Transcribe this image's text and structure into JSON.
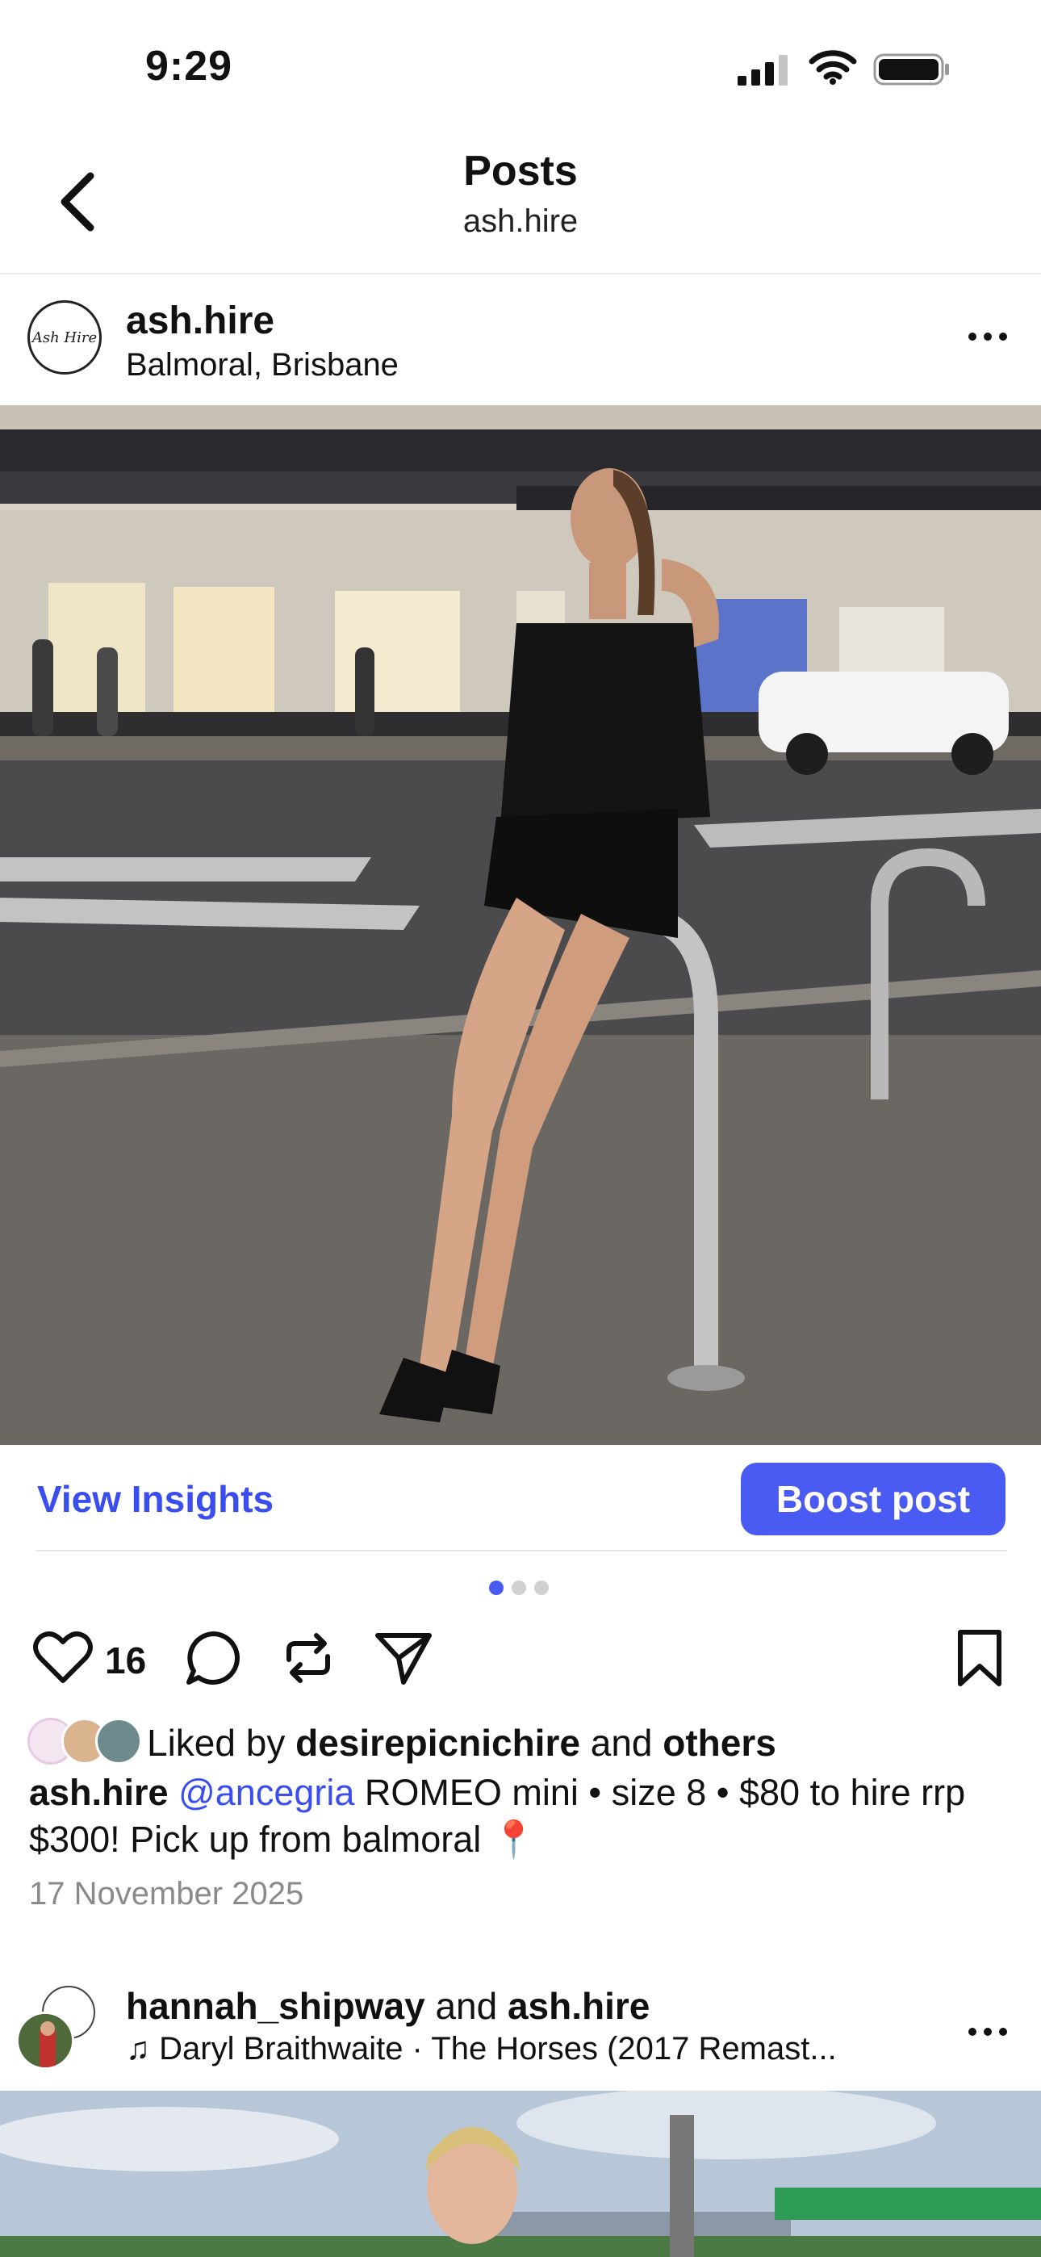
{
  "status_bar": {
    "time": "9:29"
  },
  "nav": {
    "title": "Posts",
    "subtitle": "ash.hire"
  },
  "post": {
    "avatar_text": "Ash Hire",
    "username": "ash.hire",
    "location": "Balmoral, Brisbane",
    "view_insights_label": "View Insights",
    "boost_label": "Boost post",
    "like_count": "16",
    "liked_by_prefix": "Liked by",
    "liked_by_user": "desirepicnichire",
    "liked_by_and": "and",
    "liked_by_others": "others",
    "caption_user": "ash.hire",
    "caption_mention": "@ancegria",
    "caption_text": "ROMEO mini • size 8 • $80 to hire rrp $300! Pick up from balmoral 📍",
    "date": "17 November 2025",
    "carousel": {
      "total": 3,
      "active": 1
    }
  },
  "post2": {
    "user1": "hannah_shipway",
    "and": "and",
    "user2": "ash.hire",
    "song": "♫ Daryl Braithwaite · The Horses (2017 Remast..."
  },
  "colors": {
    "accent": "#4a5bf3",
    "link": "#3a4ef0",
    "muted": "#8a8a8a"
  }
}
